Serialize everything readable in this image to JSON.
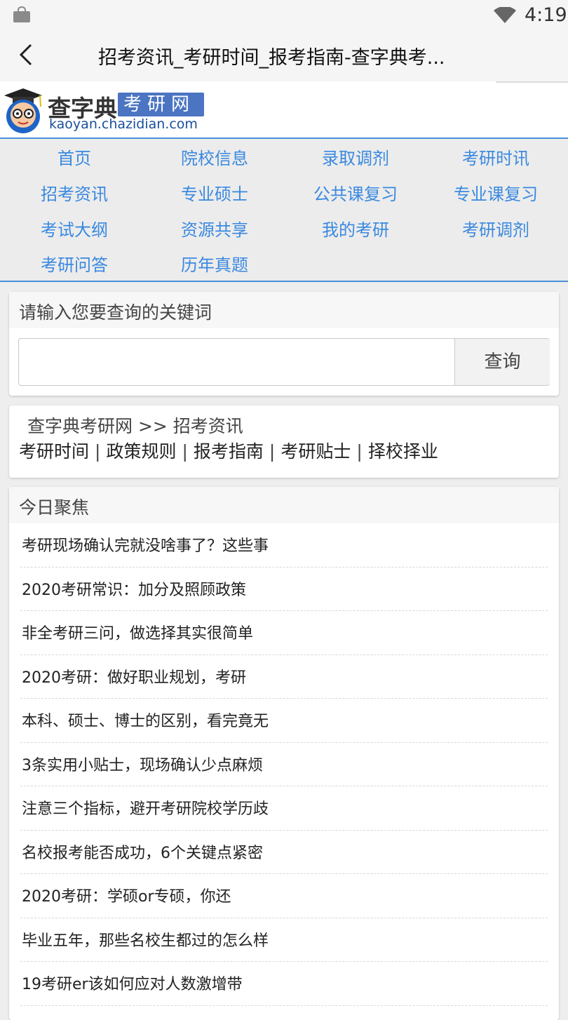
{
  "status": {
    "time": "4:19"
  },
  "appbar": {
    "title": "招考资讯_考研时间_报考指南-查字典考..."
  },
  "logo": {
    "main": "查字典",
    "tag": "考研网",
    "url": "kaoyan.chazidian.com"
  },
  "nav": {
    "items": [
      {
        "label": "首页"
      },
      {
        "label": "院校信息"
      },
      {
        "label": "录取调剂"
      },
      {
        "label": "考研时讯"
      },
      {
        "label": "招考资讯"
      },
      {
        "label": "专业硕士"
      },
      {
        "label": "公共课复习"
      },
      {
        "label": "专业课复习"
      },
      {
        "label": "考试大纲"
      },
      {
        "label": "资源共享"
      },
      {
        "label": "我的考研"
      },
      {
        "label": "考研调剂"
      },
      {
        "label": "考研问答"
      },
      {
        "label": "历年真题"
      }
    ]
  },
  "search": {
    "heading": "请输入您要查询的关键词",
    "value": "",
    "button": "查询"
  },
  "breadcrumb": {
    "text": "查字典考研网 >> 招考资讯"
  },
  "sublinks": [
    "考研时间",
    "政策规则",
    "报考指南",
    "考研贴士",
    "择校择业"
  ],
  "focus": {
    "heading": "今日聚焦",
    "items": [
      "考研现场确认完就没啥事了？这些事",
      "2020考研常识：加分及照顾政策",
      "非全考研三问，做选择其实很简单",
      "2020考研：做好职业规划，考研",
      "本科、硕士、博士的区别，看完竟无",
      "3条实用小贴士，现场确认少点麻烦",
      "注意三个指标，避开考研院校学历歧",
      "名校报考能否成功，6个关键点紧密",
      "2020考研：学硕or专硕，你还",
      "毕业五年，那些名校生都过的怎么样",
      "19考研er该如何应对人数激增带"
    ]
  },
  "colors": {
    "accent": "#3a89e0",
    "logo_tag": "#4b74c2",
    "divider": "#4a90d9"
  }
}
